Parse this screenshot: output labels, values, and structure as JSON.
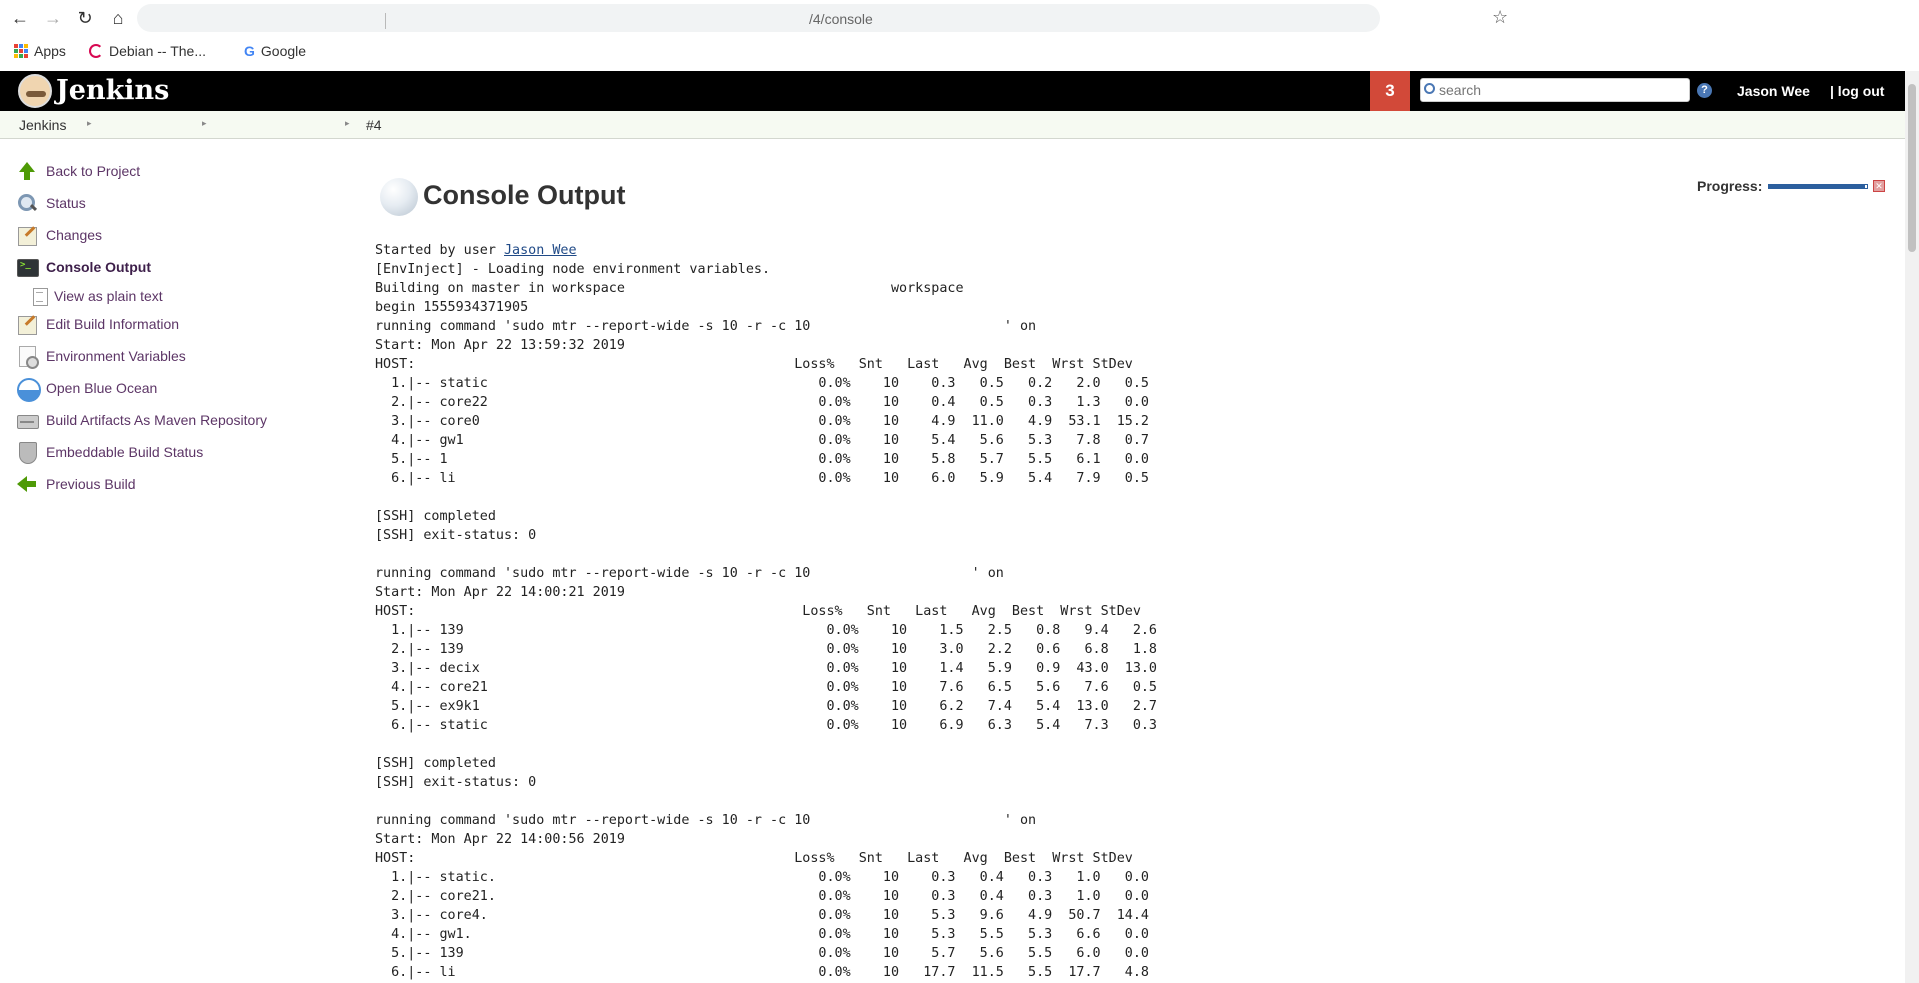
{
  "browser": {
    "url": "/4/console",
    "bookmarks": [
      {
        "label": "Apps",
        "icon": "apps-grid-icon"
      },
      {
        "label": "Debian -- The...",
        "icon": "debian-icon"
      },
      {
        "label": "Google",
        "icon": "google-icon"
      }
    ]
  },
  "header": {
    "title": "Jenkins",
    "notification_count": "3",
    "search_placeholder": "search",
    "help": "?",
    "user": "Jason Wee",
    "logout": "| log out"
  },
  "breadcrumb": {
    "root": "Jenkins",
    "build": "#4"
  },
  "sidebar": {
    "items": [
      {
        "label": "Back to Project",
        "icon": "arrow-up-icon"
      },
      {
        "label": "Status",
        "icon": "magnifier-icon"
      },
      {
        "label": "Changes",
        "icon": "notepad-icon"
      },
      {
        "label": "Console Output",
        "icon": "terminal-icon"
      },
      {
        "label": "View as plain text",
        "icon": "document-icon"
      },
      {
        "label": "Edit Build Information",
        "icon": "notepad-icon"
      },
      {
        "label": "Environment Variables",
        "icon": "env-document-icon"
      },
      {
        "label": "Open Blue Ocean",
        "icon": "blue-ocean-icon"
      },
      {
        "label": "Build Artifacts As Maven Repository",
        "icon": "drive-icon"
      },
      {
        "label": "Embeddable Build Status",
        "icon": "shield-icon"
      },
      {
        "label": "Previous Build",
        "icon": "arrow-left-icon"
      }
    ]
  },
  "main": {
    "title": "Console Output",
    "started_prefix": "Started by user ",
    "started_user": "Jason Wee",
    "console_text": "\n[EnvInject] - Loading node environment variables.\nBuilding on master in workspace                                 workspace\nbegin 1555934371905\nrunning command 'sudo mtr --report-wide -s 10 -r -c 10                        ' on\nStart: Mon Apr 22 13:59:32 2019\nHOST:                                               Loss%   Snt   Last   Avg  Best  Wrst StDev\n  1.|-- static                                         0.0%    10    0.3   0.5   0.2   2.0   0.5\n  2.|-- core22                                         0.0%    10    0.4   0.5   0.3   1.3   0.0\n  3.|-- core0                                          0.0%    10    4.9  11.0   4.9  53.1  15.2\n  4.|-- gw1                                            0.0%    10    5.4   5.6   5.3   7.8   0.7\n  5.|-- 1                                              0.0%    10    5.8   5.7   5.5   6.1   0.0\n  6.|-- li                                             0.0%    10    6.0   5.9   5.4   7.9   0.5\n\n[SSH] completed\n[SSH] exit-status: 0\n\nrunning command 'sudo mtr --report-wide -s 10 -r -c 10                    ' on\nStart: Mon Apr 22 14:00:21 2019\nHOST:                                                Loss%   Snt   Last   Avg  Best  Wrst StDev\n  1.|-- 139                                             0.0%    10    1.5   2.5   0.8   9.4   2.6\n  2.|-- 139                                             0.0%    10    3.0   2.2   0.6   6.8   1.8\n  3.|-- decix                                           0.0%    10    1.4   5.9   0.9  43.0  13.0\n  4.|-- core21                                          0.0%    10    7.6   6.5   5.6   7.6   0.5\n  5.|-- ex9k1                                           0.0%    10    6.2   7.4   5.4  13.0   2.7\n  6.|-- static                                          0.0%    10    6.9   6.3   5.4   7.3   0.3\n\n[SSH] completed\n[SSH] exit-status: 0\n\nrunning command 'sudo mtr --report-wide -s 10 -r -c 10                        ' on\nStart: Mon Apr 22 14:00:56 2019\nHOST:                                               Loss%   Snt   Last   Avg  Best  Wrst StDev\n  1.|-- static.                                        0.0%    10    0.3   0.4   0.3   1.0   0.0\n  2.|-- core21.                                        0.0%    10    0.3   0.4   0.3   1.0   0.0\n  3.|-- core4.                                         0.0%    10    5.3   9.6   4.9  50.7  14.4\n  4.|-- gw1.                                           0.0%    10    5.3   5.5   5.3   6.6   0.0\n  5.|-- 139                                            0.0%    10    5.7   5.6   5.5   6.0   0.0\n  6.|-- li                                             0.0%    10   17.7  11.5   5.5  17.7   4.8"
  },
  "progress": {
    "label": "Progress:",
    "fraction": 0.98,
    "stop": "✕"
  }
}
